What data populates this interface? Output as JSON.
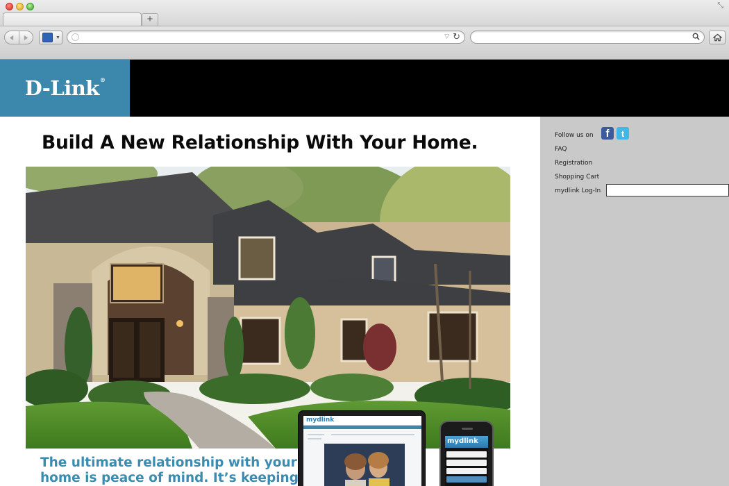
{
  "browser": {
    "url": "",
    "search_query": "",
    "new_tab_label": "+",
    "icons": [
      "back-arrow-icon",
      "forward-arrow-icon",
      "site-favicon",
      "reload-icon",
      "search-icon",
      "home-icon"
    ]
  },
  "header": {
    "logo": "D-Link",
    "logo_mark": "®",
    "brand_color": "#3c88ad"
  },
  "main": {
    "headline": "Build A New Relationship With Your Home.",
    "tagline_line1": "The ultimate relationship with your",
    "tagline_line2": "home is peace of mind. It’s keeping",
    "tagline_color": "#3a8cb0"
  },
  "devices": {
    "tablet_brand": "mydlink",
    "phone_brand": "mydlink"
  },
  "sidebar": {
    "follow_label": "Follow us on",
    "social": [
      {
        "name": "facebook",
        "glyph": "f"
      },
      {
        "name": "twitter",
        "glyph": "t"
      }
    ],
    "links": [
      {
        "label": "FAQ"
      },
      {
        "label": "Registration"
      },
      {
        "label": "Shopping Cart"
      }
    ],
    "login_label": "mydlink Log-In",
    "login_value": ""
  }
}
